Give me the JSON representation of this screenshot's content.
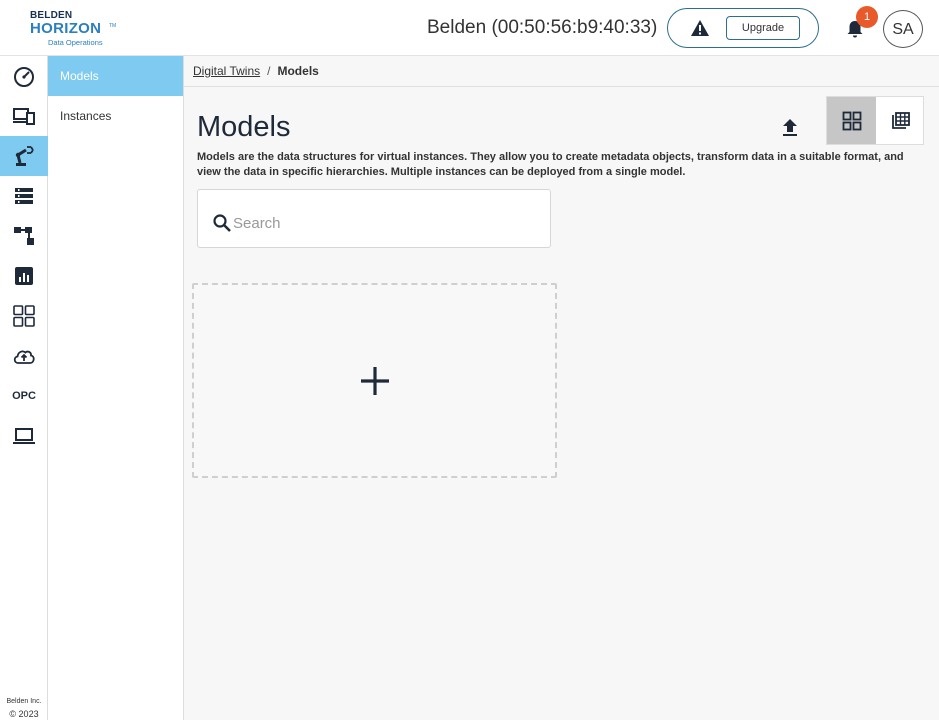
{
  "header": {
    "logo": {
      "line1": "BELDEN",
      "line2": "HORIZON",
      "line3": "Data Operations",
      "trademark": "TM"
    },
    "device_name": "Belden (00:50:56:b9:40:33)",
    "upgrade_label": "Upgrade",
    "notification_count": "1",
    "avatar_initials": "SA"
  },
  "rail": {
    "items": [
      {
        "name": "dashboard-gauge-icon"
      },
      {
        "name": "devices-icon"
      },
      {
        "name": "robot-arm-icon",
        "active": true
      },
      {
        "name": "list-icon"
      },
      {
        "name": "hierarchy-icon"
      },
      {
        "name": "analytics-icon"
      },
      {
        "name": "apps-grid-icon"
      },
      {
        "name": "cloud-upload-icon"
      },
      {
        "name": "opc",
        "label": "OPC"
      },
      {
        "name": "laptop-icon"
      }
    ],
    "copyright_line1": "Belden Inc.",
    "copyright_line2": "© 2023"
  },
  "subnav": {
    "items": [
      {
        "label": "Models",
        "active": true
      },
      {
        "label": "Instances",
        "active": false
      }
    ]
  },
  "breadcrumb": {
    "parent": "Digital Twins",
    "separator": "/",
    "current": "Models"
  },
  "main": {
    "title": "Models",
    "description": "Models are the data structures for virtual instances. They allow you to create metadata objects, transform data in a suitable format, and view the data in specific hierarchies. Multiple instances can be deployed from a single model.",
    "search_placeholder": "Search",
    "search_value": "",
    "view_mode": "grid"
  },
  "colors": {
    "accent": "#7fcaf0",
    "brand_blue": "#2b7fc0",
    "navy": "#15314f",
    "badge": "#e85a2a",
    "toggle_active": "#c6c6c6"
  }
}
